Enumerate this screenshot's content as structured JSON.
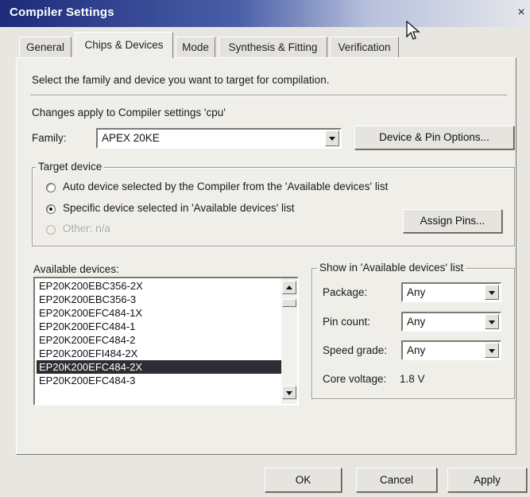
{
  "window": {
    "title": "Compiler Settings",
    "close": "×"
  },
  "tabs": [
    "General",
    "Chips & Devices",
    "Mode",
    "Synthesis & Fitting",
    "Verification"
  ],
  "chips": {
    "instruction": "Select the family and device you want to target for compilation.",
    "changes_note": "Changes apply to Compiler settings 'cpu'",
    "family_label": "Family:",
    "family_value": "APEX 20KE",
    "device_pin_options_button": "Device & Pin Options...",
    "target_device": {
      "title": "Target device",
      "option_auto": "Auto device selected by the Compiler from the 'Available devices' list",
      "option_specific": "Specific device selected in 'Available devices' list",
      "option_other": "Other:  n/a",
      "selected": "specific"
    },
    "assign_pins_button": "Assign Pins...",
    "available_devices_label": "Available devices:",
    "devices": [
      "EP20K200EBC356-2X",
      "EP20K200EBC356-3",
      "EP20K200EFC484-1X",
      "EP20K200EFC484-1",
      "EP20K200EFC484-2",
      "EP20K200EFI484-2X",
      "EP20K200EFC484-2X",
      "EP20K200EFC484-3"
    ],
    "selected_device": "EP20K200EFC484-2X",
    "show_in_list": {
      "title": "Show in 'Available devices' list",
      "package_label": "Package:",
      "package_value": "Any",
      "pin_count_label": "Pin count:",
      "pin_count_value": "Any",
      "speed_grade_label": "Speed grade:",
      "speed_grade_value": "Any",
      "core_voltage_label": "Core voltage:",
      "core_voltage_value": "1.8 V"
    }
  },
  "buttons": {
    "ok": "OK",
    "cancel": "Cancel",
    "apply": "Apply"
  },
  "colors": {
    "title_gradient_start": "#1d2b7a",
    "selection": "#2d2d33",
    "dialog_bg": "#efeee9"
  },
  "icons": {
    "cursor": "mouse-pointer-icon",
    "close": "close-icon"
  }
}
